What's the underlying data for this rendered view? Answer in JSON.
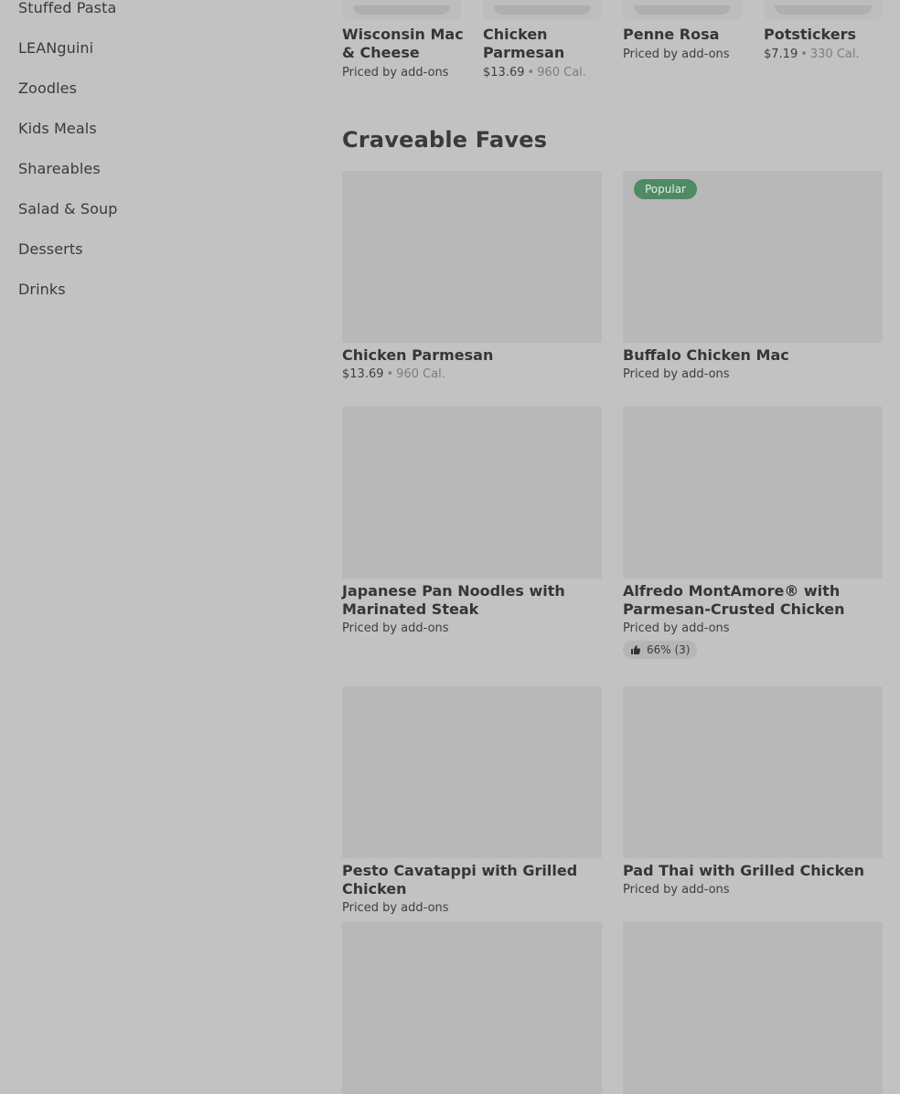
{
  "sidebar": {
    "items": [
      {
        "label": "Stuffed Pasta"
      },
      {
        "label": "LEANguini"
      },
      {
        "label": "Zoodles"
      },
      {
        "label": "Kids Meals"
      },
      {
        "label": "Shareables"
      },
      {
        "label": "Salad & Soup"
      },
      {
        "label": "Desserts"
      },
      {
        "label": "Drinks"
      }
    ]
  },
  "top_row": [
    {
      "name": "Wisconsin Mac & Cheese",
      "meta": "Priced by add-ons"
    },
    {
      "name": "Chicken Parmesan",
      "price": "$13.69",
      "cal": "960 Cal."
    },
    {
      "name": "Penne Rosa",
      "meta": "Priced by add-ons"
    },
    {
      "name": "Potstickers",
      "price": "$7.19",
      "cal": "330 Cal."
    }
  ],
  "section": {
    "title": "Craveable Faves"
  },
  "cards": [
    {
      "name": "Chicken Parmesan",
      "price": "$13.69",
      "cal": "960 Cal."
    },
    {
      "name": "Buffalo Chicken Mac",
      "meta": "Priced by add-ons",
      "badge": "Popular"
    },
    {
      "name": "Japanese Pan Noodles with Marinated Steak",
      "meta": "Priced by add-ons"
    },
    {
      "name": "Alfredo MontAmore® with Parmesan-Crusted Chicken",
      "meta": "Priced by add-ons",
      "rating": "66% (3)"
    },
    {
      "name": "Pesto Cavatappi with Grilled Chicken",
      "meta": "Priced by add-ons"
    },
    {
      "name": "Pad Thai with Grilled Chicken",
      "meta": "Priced by add-ons"
    }
  ],
  "colors": {
    "background": "#c2c2c2",
    "badge": "#4e8a63"
  }
}
